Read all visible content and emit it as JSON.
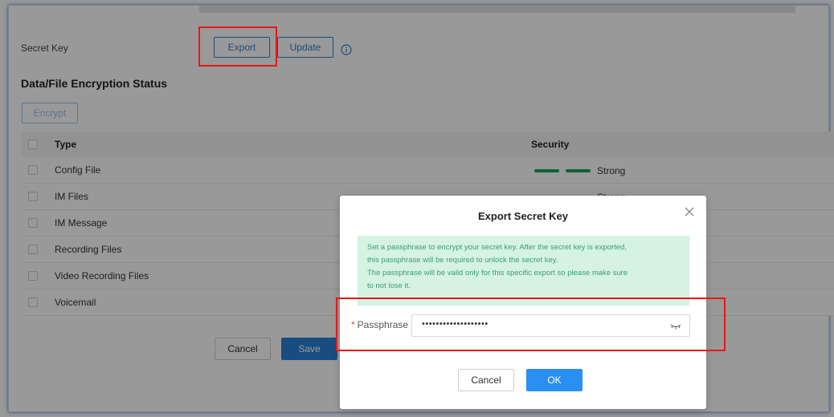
{
  "secret_key": {
    "label": "Secret Key",
    "export_label": "Export",
    "update_label": "Update",
    "info_icon": "info-icon"
  },
  "encryption": {
    "section_title": "Data/File Encryption Status",
    "encrypt_label": "Encrypt",
    "columns": {
      "type": "Type",
      "security": "Security"
    },
    "rows": [
      {
        "type": "Config File",
        "security": "Strong",
        "strength_bars": 2
      },
      {
        "type": "IM Files",
        "security": "Strong",
        "strength_bars": 2
      },
      {
        "type": "IM Message",
        "security": "",
        "strength_bars": 0
      },
      {
        "type": "Recording Files",
        "security": "",
        "strength_bars": 0
      },
      {
        "type": "Video Recording Files",
        "security": "",
        "strength_bars": 0
      },
      {
        "type": "Voicemail",
        "security": "",
        "strength_bars": 0
      }
    ]
  },
  "footer": {
    "cancel_label": "Cancel",
    "save_label": "Save"
  },
  "modal": {
    "title": "Export Secret Key",
    "notice": [
      "Set a passphrase to encrypt your secret key. After the secret key is exported,",
      "this passphrase will be required to unlock the secret key.",
      "The passphrase will be valid only for this specific export so please make sure",
      "to not lose it."
    ],
    "passphrase_label": "Passphrase",
    "required_mark": "*",
    "passphrase_value": "•••••••••••••••••••",
    "cancel_label": "Cancel",
    "ok_label": "OK"
  },
  "colors": {
    "primary": "#2a7fd6",
    "strong_bar": "#1aa262",
    "notice_bg": "#d5f2e2",
    "highlight": "#e81717"
  }
}
